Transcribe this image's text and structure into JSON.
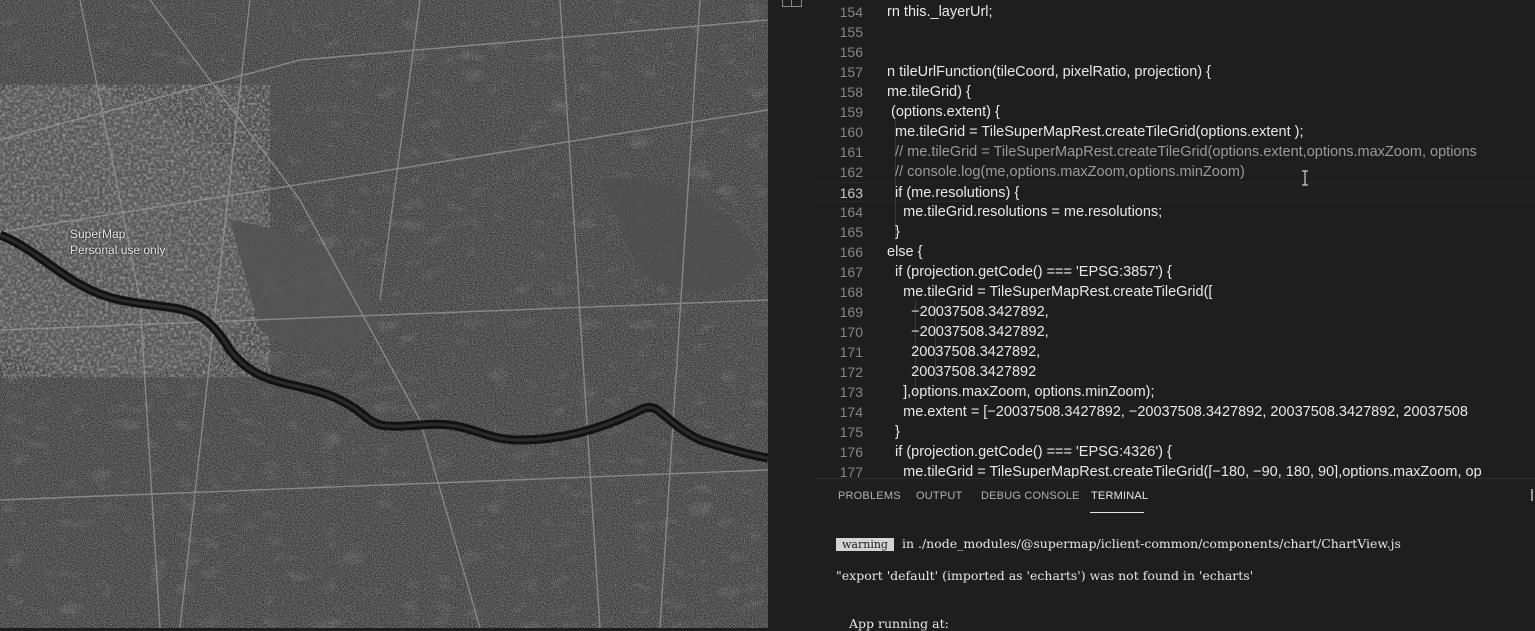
{
  "map": {
    "watermark_line1": "SuperMap",
    "watermark_line2": "Personal use only"
  },
  "editor": {
    "lines": [
      {
        "n": "154",
        "text": "rn this._layerUrl;"
      },
      {
        "n": "155",
        "text": ""
      },
      {
        "n": "156",
        "text": ""
      },
      {
        "n": "157",
        "text": "n tileUrlFunction(tileCoord, pixelRatio, projection) {"
      },
      {
        "n": "158",
        "text": "me.tileGrid) {"
      },
      {
        "n": "159",
        "text": " (options.extent) {"
      },
      {
        "n": "160",
        "text": "  me.tileGrid = TileSuperMapRest.createTileGrid(options.extent );"
      },
      {
        "n": "161",
        "text": "  // me.tileGrid = TileSuperMapRest.createTileGrid(options.extent,options.maxZoom, options"
      },
      {
        "n": "162",
        "text": "  // console.log(me,options.maxZoom,options.minZoom)"
      },
      {
        "n": "163",
        "text": "  if (me.resolutions) {"
      },
      {
        "n": "164",
        "text": "    me.tileGrid.resolutions = me.resolutions;"
      },
      {
        "n": "165",
        "text": "  }"
      },
      {
        "n": "166",
        "text": "else {"
      },
      {
        "n": "167",
        "text": "  if (projection.getCode() === 'EPSG:3857') {"
      },
      {
        "n": "168",
        "text": "    me.tileGrid = TileSuperMapRest.createTileGrid(["
      },
      {
        "n": "169",
        "text": "      −20037508.3427892,"
      },
      {
        "n": "170",
        "text": "      −20037508.3427892,"
      },
      {
        "n": "171",
        "text": "      20037508.3427892,"
      },
      {
        "n": "172",
        "text": "      20037508.3427892"
      },
      {
        "n": "173",
        "text": "    ],options.maxZoom, options.minZoom);"
      },
      {
        "n": "174",
        "text": "    me.extent = [−20037508.3427892, −20037508.3427892, 20037508.3427892, 20037508"
      },
      {
        "n": "175",
        "text": "  }"
      },
      {
        "n": "176",
        "text": "  if (projection.getCode() === 'EPSG:4326') {"
      },
      {
        "n": "177",
        "text": "    me.tileGrid = TileSuperMapRest.createTileGrid([−180, −90, 180, 90],options.maxZoom, op"
      }
    ],
    "current_line": "163"
  },
  "panel": {
    "tabs": [
      "PROBLEMS",
      "OUTPUT",
      "DEBUG CONSOLE",
      "TERMINAL"
    ],
    "active_tab": "TERMINAL",
    "terminal": {
      "warning_badge": "warning",
      "warning_text": "in ./node_modules/@supermap/iclient-common/components/chart/ChartView.js",
      "export_text": "\"export 'default' (imported as 'echarts') was not found in 'echarts'",
      "app_running": "App running at:"
    }
  }
}
